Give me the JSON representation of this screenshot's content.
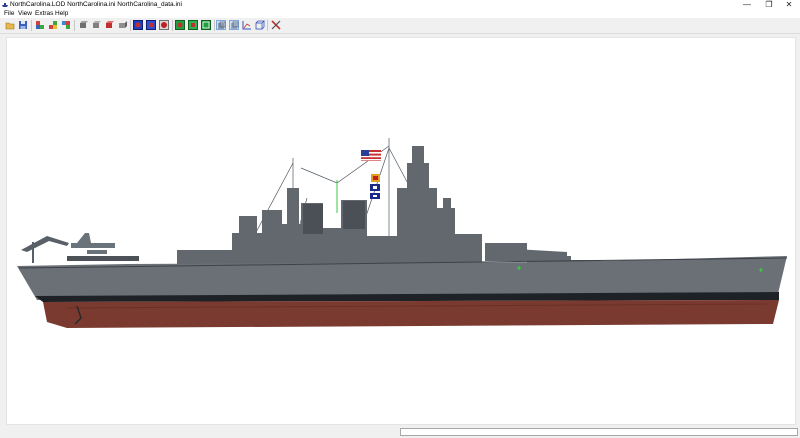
{
  "window": {
    "title": "NorthCarolina.LOD  NorthCarolina.ini  NorthCarolina_data.ini",
    "controls": {
      "minimize": "—",
      "maximize": "❐",
      "close": "✕"
    }
  },
  "menu": {
    "items": [
      {
        "label": "File"
      },
      {
        "label": "View"
      },
      {
        "label": "Extras"
      },
      {
        "label": "Help"
      }
    ]
  },
  "toolbar": {
    "buttons": [
      {
        "icon": "open-folder-icon",
        "color": "#e8b84a"
      },
      {
        "icon": "save-disk-icon",
        "color": "#3a62b8"
      },
      {
        "icon": "ship-colored-1-icon",
        "color": "#d04040"
      },
      {
        "icon": "ship-colored-2-icon",
        "color": "#3aa83a"
      },
      {
        "icon": "ship-colored-3-icon",
        "color": "#3a8ad0"
      },
      {
        "icon": "gray-block-1-icon",
        "color": "#707070"
      },
      {
        "icon": "gray-block-2-icon",
        "color": "#808080"
      },
      {
        "icon": "red-block-icon",
        "color": "#c03030"
      },
      {
        "icon": "gray-block-3-icon",
        "color": "#909090"
      },
      {
        "icon": "view-blue-1-icon",
        "color": "#2040c0"
      },
      {
        "icon": "view-blue-2-icon",
        "color": "#3050d0"
      },
      {
        "icon": "view-red-icon",
        "color": "#c02020"
      },
      {
        "icon": "view-green-1-icon",
        "color": "#20a040"
      },
      {
        "icon": "view-green-2-icon",
        "color": "#30b050"
      },
      {
        "icon": "view-green-3-icon",
        "color": "#20a040"
      },
      {
        "icon": "toggle-pressed-1-icon",
        "color": "#7fa8d8"
      },
      {
        "icon": "toggle-pressed-2-icon",
        "color": "#7fa8d8"
      },
      {
        "icon": "axis-chart-icon",
        "color": "#3050c0"
      },
      {
        "icon": "cube-3d-icon",
        "color": "#3050c0"
      },
      {
        "icon": "tools-wrench-icon",
        "color": "#c03030"
      }
    ]
  },
  "status": {
    "text": ""
  }
}
